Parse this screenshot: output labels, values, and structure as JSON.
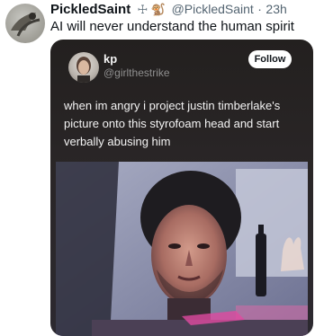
{
  "outer_tweet": {
    "display_name": "PickledSaint",
    "badges": "☩ 🐒",
    "handle": "@PickledSaint",
    "separator": "·",
    "time": "23h",
    "text": "AI will never understand the human spirit"
  },
  "quoted_tweet": {
    "display_name": "kp",
    "handle": "@girlthestrike",
    "follow_label": "Follow",
    "text": "when im angry i project justin timberlake's picture onto this styrofoam head and start verbally abusing him"
  },
  "colors": {
    "text_primary": "#0f1419",
    "text_secondary": "#536471",
    "card_bg": "#23201f",
    "card_text": "#f4f4f4"
  }
}
